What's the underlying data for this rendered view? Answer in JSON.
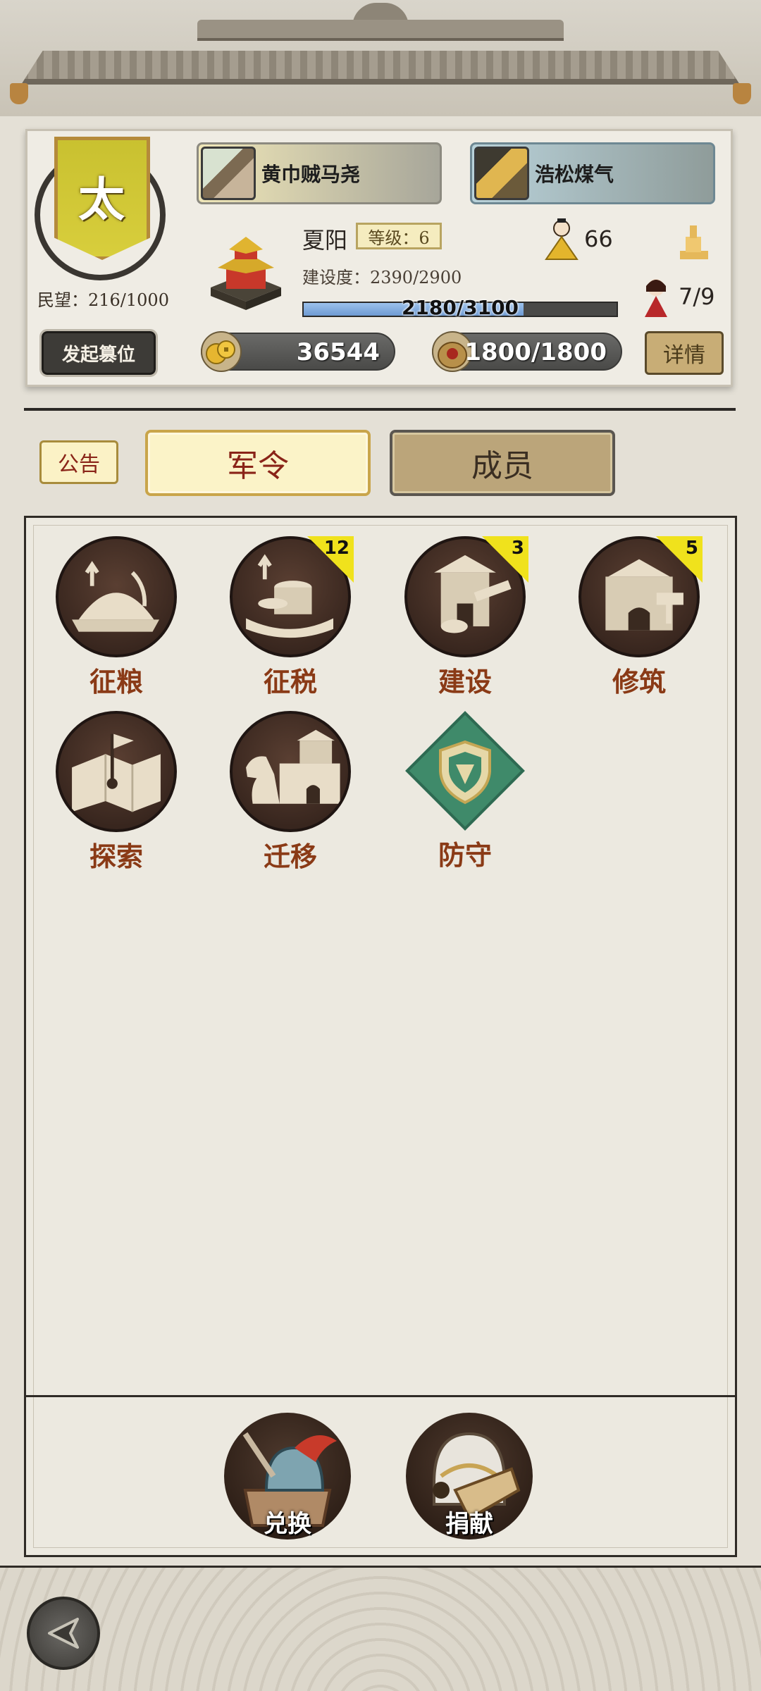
{
  "banner": {
    "char": "太",
    "minwang": "民望：216/1000"
  },
  "buttons": {
    "usurp": "发起篡位",
    "detail": "详情",
    "notice": "公告"
  },
  "members": [
    {
      "name": "黄巾贼马尧"
    },
    {
      "name": "浩松煤气"
    }
  ],
  "city": {
    "name": "夏阳",
    "level": "等级：6",
    "construction": "建设度：2390/2900",
    "progress_text": "2180/3100",
    "progress_fraction": 0.703,
    "officials": "66",
    "maids": "7/9"
  },
  "resources": {
    "coins": "36544",
    "grain": "1800/1800"
  },
  "tabs": {
    "orders": "军令",
    "members": "成员"
  },
  "commands": [
    {
      "label": "征粮",
      "badge": "",
      "icon": "grain-collect-icon"
    },
    {
      "label": "征税",
      "badge": "12",
      "icon": "tax-coins-icon"
    },
    {
      "label": "建设",
      "badge": "3",
      "icon": "construction-icon"
    },
    {
      "label": "修筑",
      "badge": "5",
      "icon": "fortify-icon"
    },
    {
      "label": "探索",
      "badge": "",
      "icon": "explore-map-icon"
    },
    {
      "label": "迁移",
      "badge": "",
      "icon": "migrate-horse-icon"
    },
    {
      "label": "防守",
      "badge": "",
      "icon": "defense-shield-icon"
    }
  ],
  "bottom": {
    "exchange": "兑换",
    "donate": "捐献"
  },
  "colors": {
    "accent_red": "#8a2418",
    "banner_yellow": "#c9c130",
    "badge_yellow": "#f0e21c",
    "defense_green": "#3f8a6a"
  }
}
